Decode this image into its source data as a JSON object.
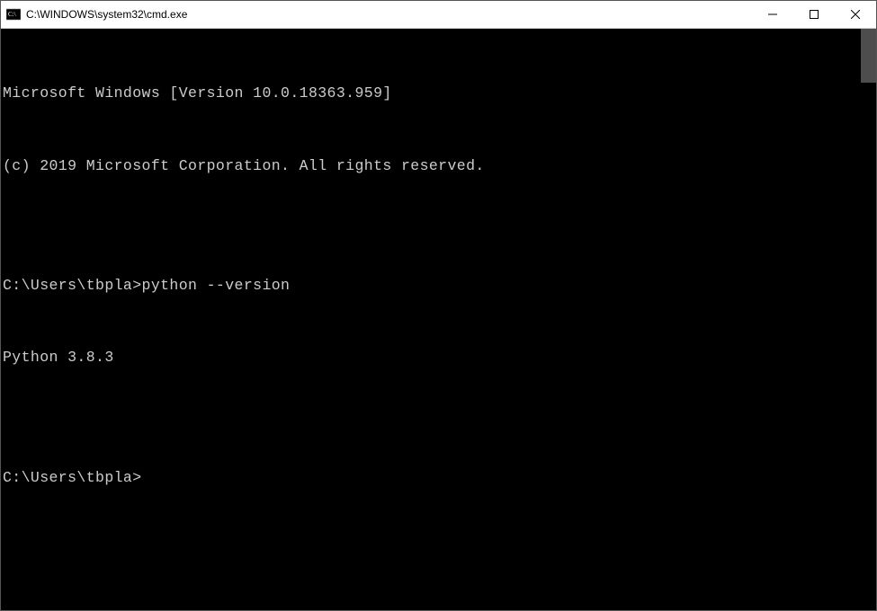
{
  "window": {
    "title": "C:\\WINDOWS\\system32\\cmd.exe"
  },
  "terminal": {
    "lines": [
      "Microsoft Windows [Version 10.0.18363.959]",
      "(c) 2019 Microsoft Corporation. All rights reserved.",
      "",
      "C:\\Users\\tbpla>python --version",
      "Python 3.8.3",
      "",
      "C:\\Users\\tbpla>"
    ],
    "prompt_path": "C:\\Users\\tbpla>",
    "last_command": "python --version",
    "last_output": "Python 3.8.3"
  }
}
